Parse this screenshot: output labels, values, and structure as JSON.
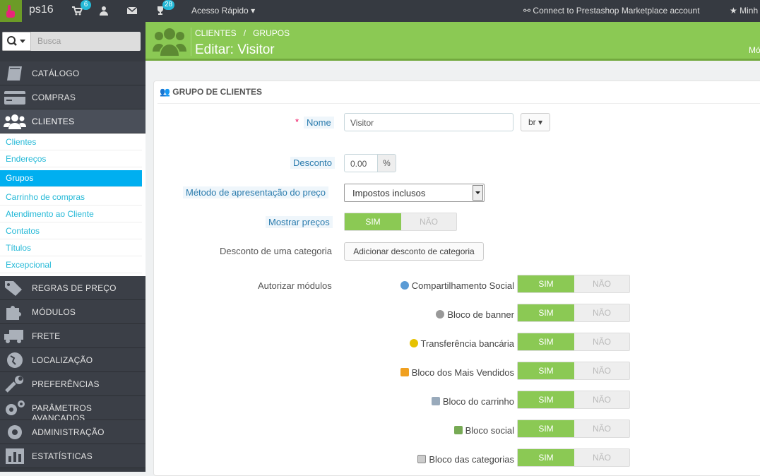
{
  "topbar": {
    "shop_name": "ps16",
    "orders_count": "6",
    "messages_count": "28",
    "quick_access": "Acesso Rápido",
    "marketplace": "Connect to Prestashop Marketplace account",
    "my_account": "Minh"
  },
  "sidebar": {
    "search_placeholder": "Busca",
    "items": [
      {
        "label": "CATÁLOGO",
        "icon": "book-icon"
      },
      {
        "label": "COMPRAS",
        "icon": "credit-card-icon"
      },
      {
        "label": "CLIENTES",
        "icon": "users-icon"
      },
      {
        "label": "REGRAS DE PREÇO",
        "icon": "tags-icon"
      },
      {
        "label": "MÓDULOS",
        "icon": "puzzle-icon"
      },
      {
        "label": "FRETE",
        "icon": "truck-icon"
      },
      {
        "label": "LOCALIZAÇÃO",
        "icon": "globe-icon"
      },
      {
        "label": "PREFERÊNCIAS",
        "icon": "wrench-icon"
      },
      {
        "label": "PARÂMETROS AVANÇADOS",
        "icon": "cogs-icon"
      },
      {
        "label": "ADMINISTRAÇÃO",
        "icon": "gear-icon"
      },
      {
        "label": "ESTATÍSTICAS",
        "icon": "bar-chart-icon"
      }
    ],
    "submenu": [
      {
        "label": "Clientes"
      },
      {
        "label": "Endereços"
      },
      {
        "label": "Grupos"
      },
      {
        "label": "Carrinho de compras"
      },
      {
        "label": "Atendimento ao Cliente"
      },
      {
        "label": "Contatos"
      },
      {
        "label": "Títulos"
      },
      {
        "label": "Excepcional"
      }
    ]
  },
  "header": {
    "breadcrumb_1": "CLIENTES",
    "breadcrumb_sep": "/",
    "breadcrumb_2": "GRUPOS",
    "title": "Editar: Visitor",
    "right_truncated": "Mó"
  },
  "panel": {
    "heading": "GRUPO DE CLIENTES",
    "name_label": "Nome",
    "name_value": "Visitor",
    "lang_value": "br",
    "discount_label": "Desconto",
    "discount_value": "0.00",
    "discount_unit": "%",
    "price_method_label": "Método de apresentação do preço",
    "price_method_value": "Impostos inclusos",
    "show_prices_label": "Mostrar preços",
    "yes": "SIM",
    "no": "NÃO",
    "category_discount_label": "Desconto de uma categoria",
    "category_discount_button": "Adicionar desconto de categoria",
    "modules_label": "Autorizar módulos",
    "modules": [
      {
        "label": "Compartilhamento Social",
        "icon": "share-icon"
      },
      {
        "label": "Bloco de banner",
        "icon": "gear-icon"
      },
      {
        "label": "Transferência bancária",
        "icon": "coins-icon"
      },
      {
        "label": "Bloco dos Mais Vendidos",
        "icon": "medal-icon"
      },
      {
        "label": "Bloco do carrinho",
        "icon": "basket-icon"
      },
      {
        "label": "Bloco social",
        "icon": "social-icon"
      },
      {
        "label": "Bloco das categorias",
        "icon": "list-icon"
      }
    ]
  },
  "colors": {
    "topbar_bg": "#363a41",
    "header_green": "#8bc954",
    "active_blue": "#00aff0",
    "link_blue": "#25b9d7"
  }
}
